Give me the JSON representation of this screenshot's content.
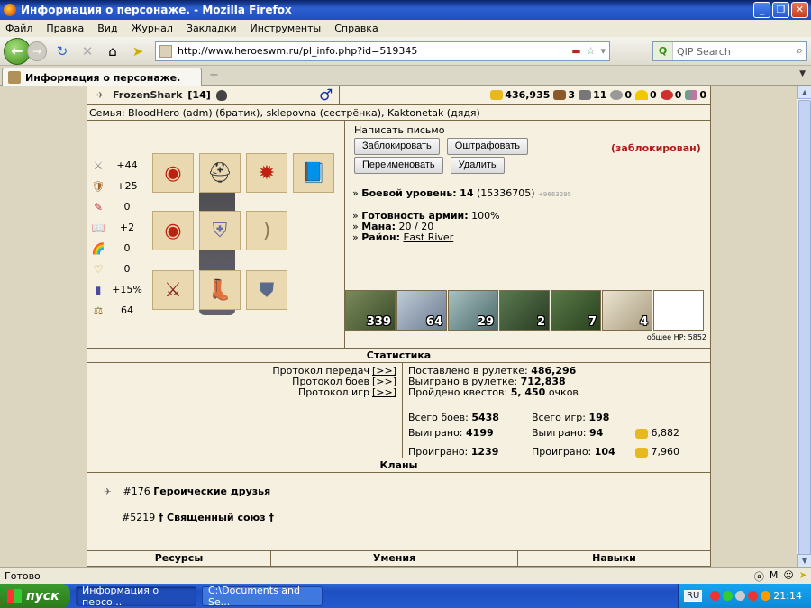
{
  "window": {
    "title": "Информация о персонаже. - Mozilla Firefox"
  },
  "menu": [
    "Файл",
    "Правка",
    "Вид",
    "Журнал",
    "Закладки",
    "Инструменты",
    "Справка"
  ],
  "nav": {
    "url": "http://www.heroeswm.ru/pl_info.php?id=519345",
    "search_placeholder": "QIP Search"
  },
  "tab": {
    "label": "Информация о персонаже."
  },
  "character": {
    "name": "FrozenShark",
    "level": "[14]",
    "family": "Семья: BloodHero (adm) (братик), sklepovna (сестрёнка), Kaktonetak (дядя)"
  },
  "resources": {
    "gold": "436,935",
    "wood": "3",
    "ore": "11",
    "mercury": "0",
    "sulfur": "0",
    "crystals": "0",
    "gems": "0"
  },
  "stats": [
    {
      "icon": "attack-icon",
      "glyph": "⚔",
      "value": "+44"
    },
    {
      "icon": "defense-icon",
      "glyph": "🛡",
      "value": "+25"
    },
    {
      "icon": "spellpower-icon",
      "glyph": "✎",
      "value": "0"
    },
    {
      "icon": "knowledge-icon",
      "glyph": "📖",
      "value": "+2"
    },
    {
      "icon": "luck-icon",
      "glyph": "🌈",
      "value": "0"
    },
    {
      "icon": "morale-icon",
      "glyph": "♡",
      "value": "0"
    },
    {
      "icon": "initiative-icon",
      "glyph": "▮",
      "value": "+15%"
    },
    {
      "icon": "weight-icon",
      "glyph": "⚖",
      "value": "64"
    }
  ],
  "actions": {
    "write_letter": "Написать письмо",
    "block": "Заблокировать",
    "fine": "Оштрафовать",
    "rename": "Переименовать",
    "delete": "Удалить",
    "blocked_status": "(заблокирован)"
  },
  "info": {
    "combat_level_label": "Боевой уровень:",
    "combat_level": "14",
    "combat_exp": "(15336705)",
    "combat_exp_extra": "+9663295",
    "army_ready_label": "Готовность армии:",
    "army_ready": "100%",
    "mana_label": "Мана:",
    "mana": "20 / 20",
    "district_label": "Район:",
    "district": "East River"
  },
  "army": [
    {
      "count": "339",
      "color": "#5c6b3c"
    },
    {
      "count": "64",
      "color": "#8aa0b8"
    },
    {
      "count": "29",
      "color": "#6a8a8a"
    },
    {
      "count": "2",
      "color": "#3f5a38"
    },
    {
      "count": "7",
      "color": "#3c5a30"
    },
    {
      "count": "4",
      "color": "#cfc4a8"
    },
    {
      "count": "",
      "color": "#ffffff"
    }
  ],
  "total_hp": "общее HP: 5852",
  "statistics": {
    "header": "Статистика",
    "protocols": [
      {
        "label": "Протокол передач",
        "link": "[>>]"
      },
      {
        "label": "Протокол боев",
        "link": "[>>]"
      },
      {
        "label": "Протокол игр",
        "link": "[>>]"
      }
    ],
    "roulette_bet_label": "Поставлено в рулетке:",
    "roulette_bet": "486,296",
    "roulette_won_label": "Выиграно в рулетке:",
    "roulette_won": "712,838",
    "quests_label": "Пройдено квестов:",
    "quests": "5, 450",
    "quests_unit": "очков",
    "battles_label": "Всего боев:",
    "battles": "5438",
    "games_label": "Всего игр:",
    "games": "198",
    "battles_won_label": "Выиграно:",
    "battles_won": "4199",
    "games_won_label": "Выиграно:",
    "games_won": "94",
    "games_won_gold": "6,882",
    "battles_lost_label": "Проиграно:",
    "battles_lost": "1239",
    "games_lost_label": "Проиграно:",
    "games_lost": "104",
    "games_lost_gold": "7,960"
  },
  "clans": {
    "header": "Кланы",
    "items": [
      {
        "id": "#176",
        "name": "Героические друзья"
      },
      {
        "id": "#5219",
        "name": "† Священный союз †"
      }
    ]
  },
  "bottom_headers": {
    "resources": "Ресурсы",
    "skills": "Умения",
    "abilities": "Навыки"
  },
  "status": {
    "text": "Готово"
  },
  "taskbar": {
    "start": "пуск",
    "tasks": [
      "Информация о персо...",
      "C:\\Documents and Se..."
    ],
    "lang": "RU",
    "clock": "21:14"
  }
}
